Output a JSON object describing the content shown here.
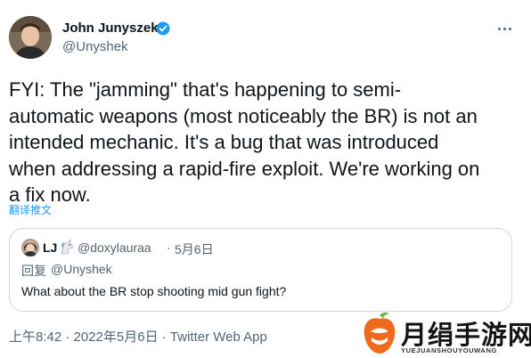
{
  "author": {
    "display_name": "John Junyszek",
    "handle": "@Unyshek",
    "verified": true,
    "avatar_icon": "person-avatar"
  },
  "tweet": {
    "text": "FYI: The \"jamming\" that's happening to semi-\nautomatic weapons (most noticeably the BR) is not an\nintended mechanic. It's a bug that was introduced\nwhen addressing a rapid-fire exploit. We're working on\na fix now.",
    "translate_label": "翻译推文"
  },
  "quote": {
    "name": "LJ",
    "handle": "@doxylauraa",
    "separator": "·",
    "date": "5月6日",
    "reply_label": "回复",
    "reply_handle": "@Unyshek",
    "text": "What about the BR stop shooting mid gun fight?"
  },
  "meta": {
    "timestamp": "上午8:42 · 2022年5月6日 · ",
    "app": "Twitter Web App"
  },
  "watermark": {
    "text": "月绢手游网",
    "sub": "YUEJUANSHOUYOUWANG"
  },
  "colors": {
    "text": "#0f1419",
    "muted": "#536471",
    "link": "#1d9bf0",
    "border": "#cfd9de",
    "watermark_orange": "#f06a1e"
  }
}
